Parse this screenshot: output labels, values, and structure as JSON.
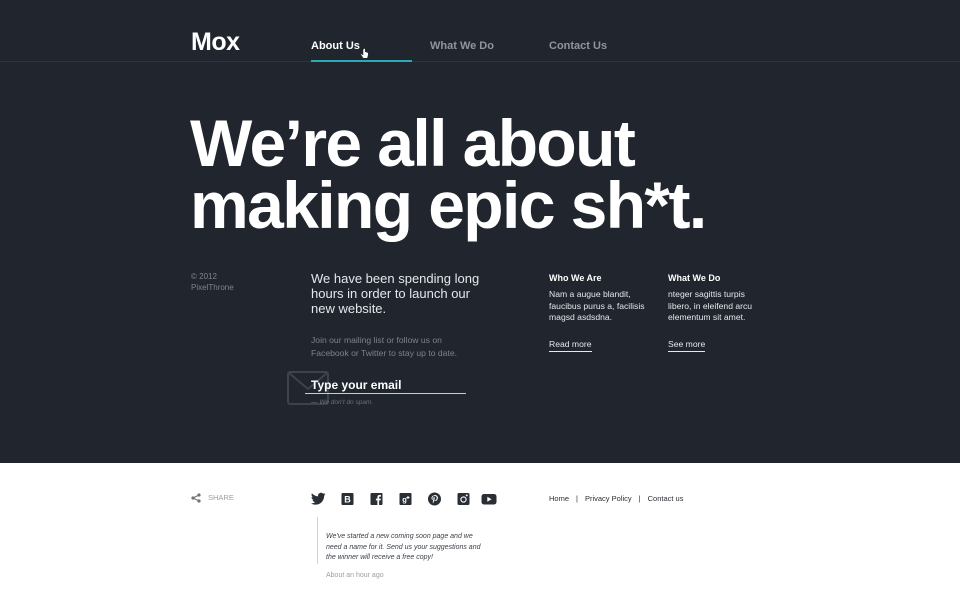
{
  "header": {
    "logo": "Mox",
    "nav": [
      {
        "label": "About Us",
        "active": true
      },
      {
        "label": "What We Do",
        "active": false
      },
      {
        "label": "Contact Us",
        "active": false
      }
    ]
  },
  "hero": {
    "headline_line1": "We’re all about",
    "headline_line2": "making epic sh*t.",
    "copyright_year": "© 2012",
    "copyright_owner": "PixelThrone",
    "intro": "We have been spending long hours in order to launch our new website.",
    "subtext": "Join our mailing list or follow us on Facebook or Twitter to stay up to date.",
    "email_placeholder": "Type your email",
    "no_spam": "— We don't do spam.",
    "columns": [
      {
        "title": "Who We Are",
        "body": "Nam a augue blandit,\nfaucibus purus a, facilisis\nmagsd asdsdna.",
        "link": "Read more"
      },
      {
        "title": "What We Do",
        "body": "nteger sagittis turpis\nlibero, in eleifend arcu\nelementum sit amet.",
        "link": "See more"
      }
    ]
  },
  "footer": {
    "share_label": "SHARE",
    "social_icons": [
      "twitter-icon",
      "b-icon",
      "facebook-icon",
      "google-plus-icon",
      "pinterest-icon",
      "instagram-icon",
      "youtube-icon"
    ],
    "links": [
      "Home",
      "Privacy Policy",
      "Contact us"
    ],
    "tweet": "We've started a new coming soon page and we need a name for it. Send us your suggestions and the winner will receive a free copy!",
    "tweet_time": "About an hour ago"
  },
  "colors": {
    "hero_bg": "#20252e",
    "accent": "#2aa9b6",
    "footer_bg": "#ffffff"
  }
}
